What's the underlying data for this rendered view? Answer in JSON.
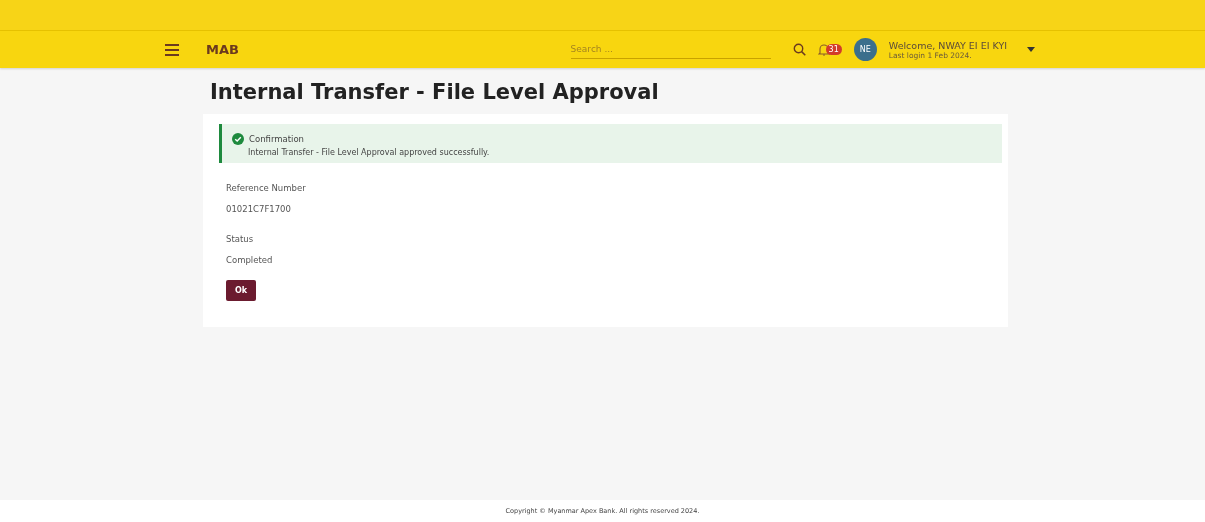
{
  "header": {
    "logo": "MAB",
    "search": {
      "placeholder": "Search ..."
    },
    "notifications": {
      "count": "31"
    },
    "user": {
      "initials": "NE",
      "welcome": "Welcome, NWAY EI EI KYI",
      "last_login": "Last login 1 Feb 2024."
    }
  },
  "page": {
    "title": "Internal Transfer - File Level Approval"
  },
  "alert": {
    "kind": "success",
    "title": "Confirmation",
    "message": "Internal Transfer - File Level Approval approved successfully."
  },
  "fields": [
    {
      "label": "Reference Number",
      "value": "01021C7F1700"
    },
    {
      "label": "Status",
      "value": "Completed"
    }
  ],
  "buttons": [
    "Ok"
  ],
  "footer": {
    "text": "Copyright © Myanmar Apex Bank. All rights reserved 2024."
  }
}
